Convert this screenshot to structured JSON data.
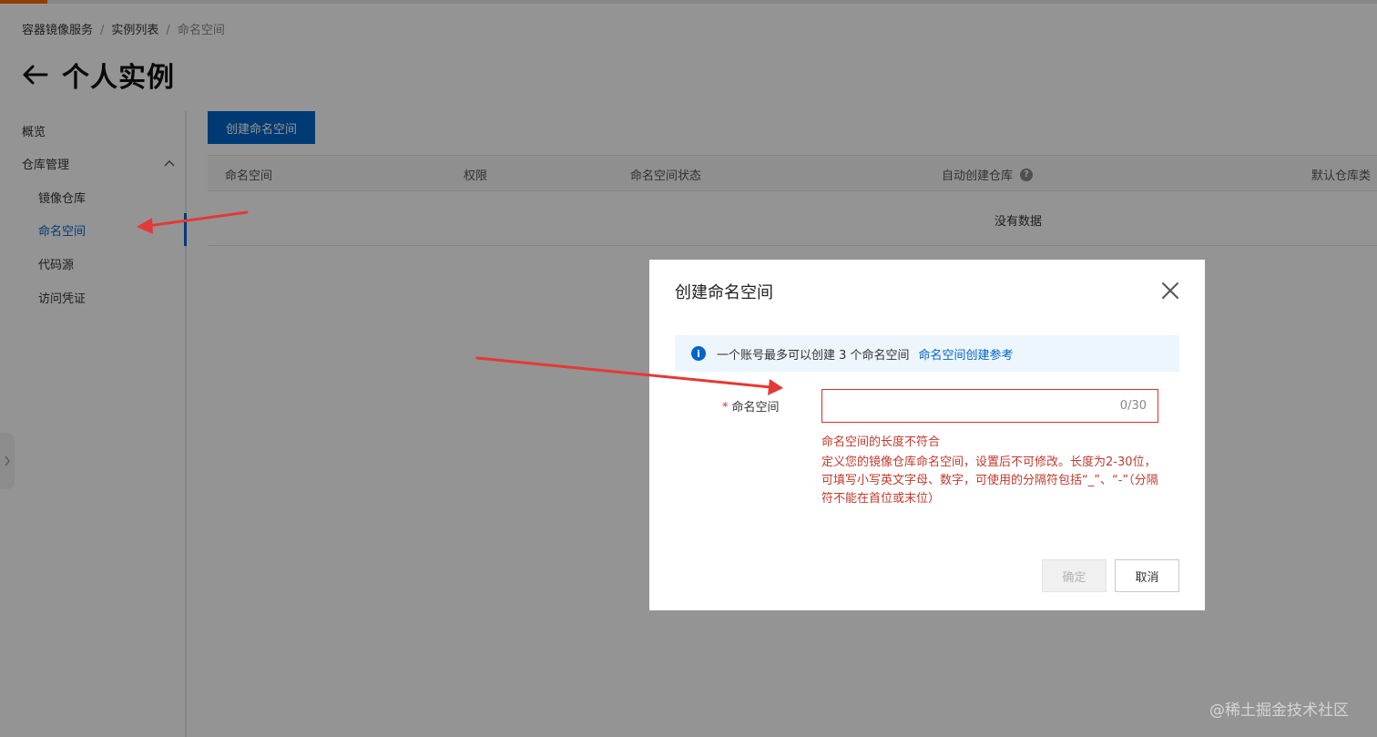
{
  "breadcrumb": {
    "items": [
      "容器镜像服务",
      "实例列表",
      "命名空间"
    ],
    "separator": "/"
  },
  "page": {
    "title": "个人实例"
  },
  "sidebar": {
    "overview": "概览",
    "group": "仓库管理",
    "items": [
      "镜像仓库",
      "命名空间",
      "代码源",
      "访问凭证"
    ],
    "active_index": 1
  },
  "main": {
    "create_button": "创建命名空间",
    "table": {
      "columns": [
        "命名空间",
        "权限",
        "命名空间状态",
        "自动创建仓库",
        "默认仓库类"
      ],
      "empty": "没有数据"
    }
  },
  "dialog": {
    "title": "创建命名空间",
    "alert_text": "一个账号最多可以创建 3 个命名空间",
    "alert_link": "命名空间创建参考",
    "field_label": "命名空间",
    "field_required_mark": "*",
    "input_value": "",
    "input_placeholder": "",
    "counter": "0/30",
    "error_main": "命名空间的长度不符合",
    "error_desc": "定义您的镜像仓库命名空间，设置后不可修改。长度为2-30位，可填写小写英文字母、数字，可使用的分隔符包括“_”、“-”（分隔符不能在首位或末位）",
    "ok_button": "确定",
    "cancel_button": "取消"
  },
  "watermark": "@稀土掘金技术社区",
  "colors": {
    "primary": "#0064c8",
    "error": "#d93026",
    "accent": "#ff6a00",
    "arrow": "#e53935"
  },
  "icons": [
    "back-arrow-icon",
    "chevron-up-icon",
    "help-icon",
    "info-icon",
    "close-icon",
    "chevron-right-icon"
  ]
}
